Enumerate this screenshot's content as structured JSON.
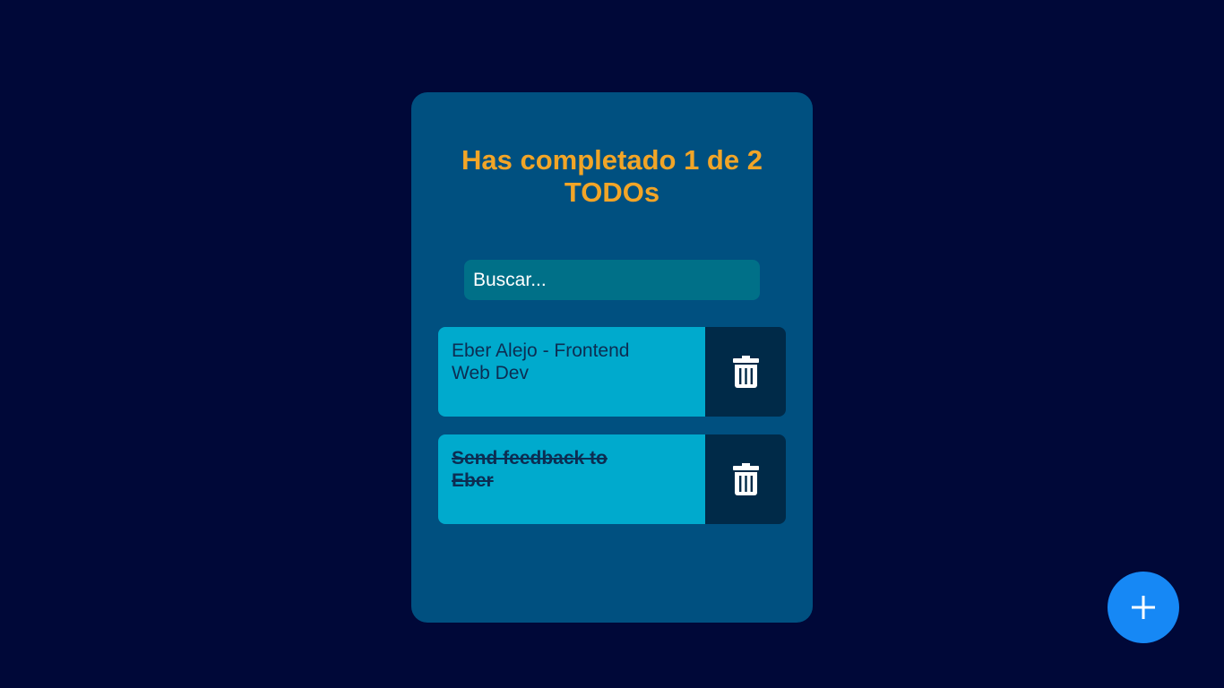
{
  "header": {
    "title": "Has completado 1 de 2 TODOs"
  },
  "search": {
    "placeholder": "Buscar...",
    "value": ""
  },
  "todos": [
    {
      "text": "Eber Alejo - Frontend Web Dev",
      "completed": false,
      "delete_icon": "trash-icon"
    },
    {
      "text": "Send feedback to Eber",
      "completed": true,
      "delete_icon": "trash-icon"
    }
  ],
  "fab": {
    "icon": "plus-icon"
  },
  "colors": {
    "background": "#000838",
    "card": "#005080",
    "title": "#f2a527",
    "search_bg": "#007088",
    "todo_bg": "#00aacd",
    "todo_text": "#0c2d52",
    "delete_bg": "#002a48",
    "fab": "#1688f5"
  }
}
